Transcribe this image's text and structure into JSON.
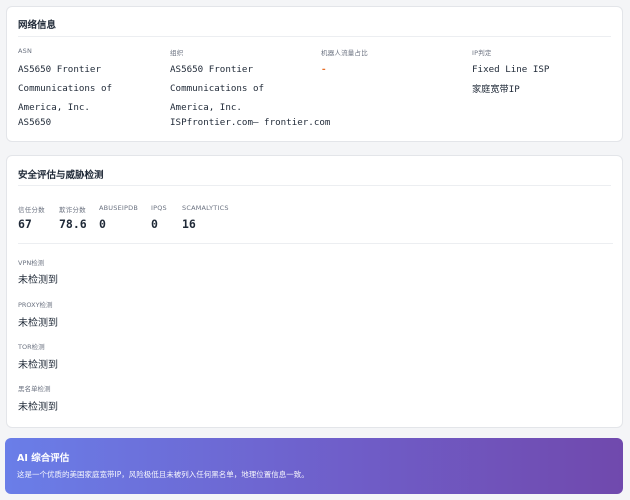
{
  "network": {
    "title": "网络信息",
    "asn": {
      "label": "ASN",
      "value": "AS5650 Frontier Communications of America, Inc.",
      "value2": "AS5650"
    },
    "org": {
      "label": "组织",
      "value": "AS5650 Frontier Communications of America, Inc.",
      "value2": "ISPfrontier.com— frontier.com"
    },
    "bot_traffic": {
      "label": "机器人流量占比",
      "value": "-"
    },
    "ip_type": {
      "label": "IP判定",
      "value": "Fixed Line ISP",
      "value2": "家庭宽带IP"
    }
  },
  "security": {
    "title": "安全评估与威胁检测",
    "scores": [
      {
        "label": "信任分数",
        "value": "67"
      },
      {
        "label": "欺诈分数",
        "value": "78.6"
      },
      {
        "label": "ABUSEIPDB",
        "value": "0"
      },
      {
        "label": "IPQS",
        "value": "0"
      },
      {
        "label": "SCAMALYTICS",
        "value": "16"
      }
    ],
    "detections": [
      {
        "label": "VPN检测",
        "value": "未检测到"
      },
      {
        "label": "PROXY检测",
        "value": "未检测到"
      },
      {
        "label": "TOR检测",
        "value": "未检测到"
      },
      {
        "label": "黑名单检测",
        "value": "未检测到"
      }
    ]
  },
  "ai": {
    "title": "AI 综合评估",
    "text": "这是一个优质的美国家庭宽带IP，风险极低且未被列入任何黑名单，地理位置信息一致。"
  },
  "colors": {
    "accent_dash": "#e8702a",
    "ai_gradient_start": "#6a7ee8",
    "ai_gradient_end": "#7049ad"
  }
}
